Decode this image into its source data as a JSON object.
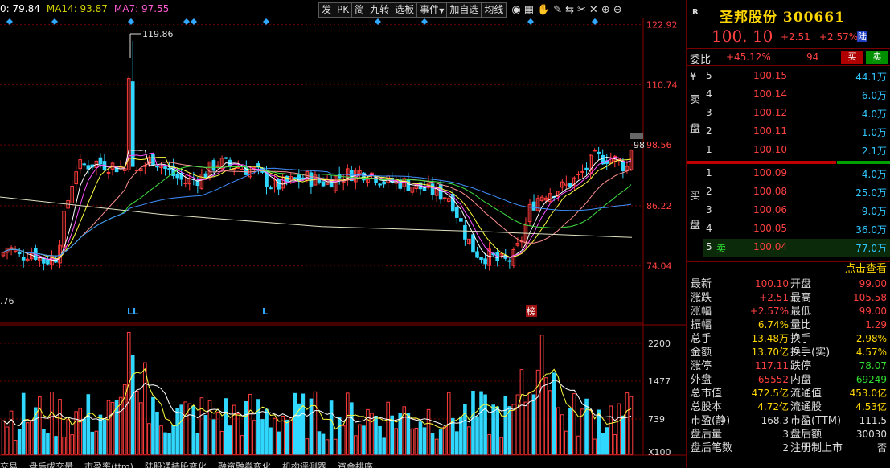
{
  "ma_legend": {
    "ma5": "0: 79.84",
    "ma14": "MA14: 93.87",
    "ma7": "MA7: 97.55"
  },
  "toolbar": {
    "buttons": [
      "发",
      "PK",
      "简",
      "九转",
      "选板",
      "事件",
      "加自选",
      "均线"
    ],
    "event_arrow": "▼"
  },
  "chart_data": {
    "type": "candlestick",
    "price_axis_ticks": [
      "122.92",
      "110.74",
      "98.56",
      "86.22",
      "74.04"
    ],
    "volume_axis_ticks": [
      "2200",
      "1477",
      "739",
      "X100"
    ],
    "high_annotation": "119.86",
    "low_annotation": ".76",
    "last_price_tag": "98",
    "markers": [
      "LL",
      "L",
      "榜"
    ],
    "colors": {
      "up": "#ff3c3c",
      "down": "#30d8ff",
      "ma_white": "#ffffff",
      "ma_yellow": "#ffff40",
      "ma_magenta": "#ff50ff",
      "ma_green": "#40e040",
      "ma_blue": "#4090ff",
      "ma_long": "#e0e0c0"
    }
  },
  "bottom_tabs": [
    "交易",
    "盘后成交量",
    "市盈率(ttm)",
    "陆股通持股变化",
    "融资融券变化",
    "机构评测器",
    "资金排序"
  ],
  "panel": {
    "badge": "R",
    "name_code": "圣邦股份 300661",
    "last_price": "100. 10",
    "change": "+2.51",
    "change_pct": "+2.57%",
    "lu_badge": "陆",
    "weibi_label": "委比",
    "weibi_value": "+45.12%",
    "weibi_diff": "94",
    "buy_btn": "买",
    "sell_btn": "卖",
    "ask_label": [
      "¥",
      "卖",
      "盘"
    ],
    "bid_label": [
      "买",
      "盘"
    ],
    "asks": [
      {
        "level": "5",
        "price": "100.15",
        "vol": "44.1万"
      },
      {
        "level": "4",
        "price": "100.14",
        "vol": "6.0万"
      },
      {
        "level": "3",
        "price": "100.12",
        "vol": "4.0万"
      },
      {
        "level": "2",
        "price": "100.11",
        "vol": "1.0万"
      },
      {
        "level": "1",
        "price": "100.10",
        "vol": "2.1万"
      }
    ],
    "bids": [
      {
        "level": "1",
        "price": "100.09",
        "vol": "4.0万"
      },
      {
        "level": "2",
        "price": "100.08",
        "vol": "25.0万"
      },
      {
        "level": "3",
        "price": "100.06",
        "vol": "9.0万"
      },
      {
        "level": "4",
        "price": "100.05",
        "vol": "36.0万"
      },
      {
        "level": "5",
        "price": "100.04",
        "vol": "77.0万"
      }
    ],
    "bid5_tag": "卖",
    "click_more": "点击查看",
    "stats_left": [
      {
        "label": "最新",
        "value": "100.10",
        "color": "red"
      },
      {
        "label": "涨跌",
        "value": "+2.51",
        "color": "red"
      },
      {
        "label": "涨幅",
        "value": "+2.57%",
        "color": "red"
      },
      {
        "label": "振幅",
        "value": "6.74%",
        "color": "yellow"
      },
      {
        "label": "总手",
        "value": "13.48万",
        "color": "yellow"
      },
      {
        "label": "金额",
        "value": "13.70亿",
        "color": "yellow"
      },
      {
        "label": "涨停",
        "value": "117.11",
        "color": "red"
      },
      {
        "label": "外盘",
        "value": "65552",
        "color": "red"
      },
      {
        "label": "总市值",
        "value": "472.5亿",
        "color": "yellow"
      },
      {
        "label": "总股本",
        "value": "4.72亿",
        "color": "yellow"
      },
      {
        "label": "市盈(静)",
        "value": "168.3",
        "color": "white"
      },
      {
        "label": "盘后量",
        "value": "3",
        "color": "white"
      },
      {
        "label": "盘后笔数",
        "value": "2",
        "color": "white"
      }
    ],
    "stats_right": [
      {
        "label": "开盘",
        "value": "99.00",
        "color": "red"
      },
      {
        "label": "最高",
        "value": "105.58",
        "color": "red"
      },
      {
        "label": "最低",
        "value": "99.00",
        "color": "red"
      },
      {
        "label": "量比",
        "value": "1.29",
        "color": "red"
      },
      {
        "label": "换手",
        "value": "2.98%",
        "color": "yellow"
      },
      {
        "label": "换手(实)",
        "value": "4.57%",
        "color": "yellow"
      },
      {
        "label": "跌停",
        "value": "78.07",
        "color": "green"
      },
      {
        "label": "内盘",
        "value": "69249",
        "color": "green"
      },
      {
        "label": "流通值",
        "value": "453.0亿",
        "color": "yellow"
      },
      {
        "label": "流通股",
        "value": "4.53亿",
        "color": "yellow"
      },
      {
        "label": "市盈(TTM)",
        "value": "111.5",
        "color": "white"
      },
      {
        "label": "盘后额",
        "value": "30030",
        "color": "white"
      },
      {
        "label": "注册制上市",
        "value": "否",
        "color": "white"
      }
    ]
  }
}
